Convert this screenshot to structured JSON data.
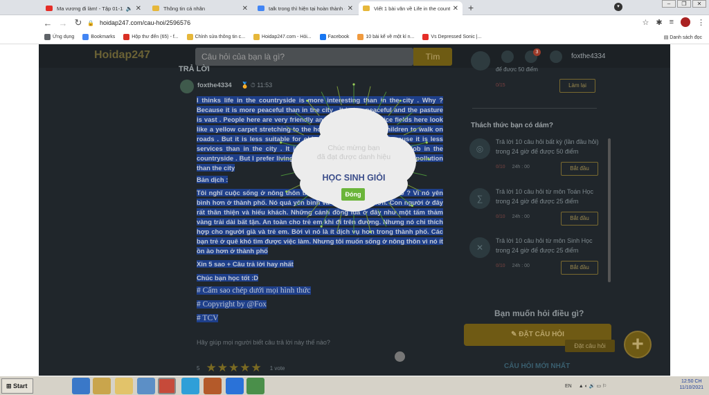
{
  "tabs": [
    {
      "title": "Ma vương đi làm! - Tập 01-13",
      "color": "#e52d27"
    },
    {
      "title": "Thông tin cá nhân",
      "color": "#e6b73a"
    },
    {
      "title": "talk trong thì hiện tại hoàn thành -",
      "color": "#4285f4"
    },
    {
      "title": "Viết 1 bài văn về Life in the country",
      "color": "#e6b73a"
    }
  ],
  "url": "hoidap247.com/cau-hoi/2596576",
  "bookmarks": [
    {
      "label": "Ứng dụng",
      "color": "#5f6368"
    },
    {
      "label": "Bookmarks",
      "color": "#4285f4"
    },
    {
      "label": "Hộp thư đến (65) - f...",
      "color": "#d93025"
    },
    {
      "label": "Chỉnh sửa thông tin c...",
      "color": "#e6b73a"
    },
    {
      "label": "Hoidap247.com - Hỏi...",
      "color": "#e6b73a"
    },
    {
      "label": "Facebook",
      "color": "#1877f2"
    },
    {
      "label": "10 bài kể về một kỉ n...",
      "color": "#f09a3e"
    },
    {
      "label": "Vs Depressed Sonic |...",
      "color": "#e52d27"
    }
  ],
  "reading_list": "Danh sách đọc",
  "site": {
    "logo": "Hoidap247",
    "search_placeholder": "Câu hỏi của bạn là gì?",
    "search_button": "Tìm",
    "notif_count": "3",
    "username": "foxthe4334"
  },
  "answer": {
    "heading": "TRẢ LỜI",
    "author": "foxthe4334",
    "time": "11:53",
    "english": "I thinks life in the countryside is more interesting than in the city . Why ? Because it is more peaceful than in the city . It is too peaceful and the pasture is vast . People here are very friendly and hospitable . The rice fields here look like a yellow carpet stretching to the horizon . It is safe for children to walk on roads . But it is less suitable for old people and children . Because it is less services than in the city . It is hard for young people to find a job in the countryside . But I prefer living in the countryside because it has less pollution than the city",
    "bandich": "Bản dịch :",
    "vietnamese": "Tôi nghĩ cuộc sống ở nông thôn thú vị hơn ở thành phố. Tại sao ? Vì nó yên bình hơn ở thành phố. Nó quá yên bình và đồng cỏ rộng lớn. Con người ở đây rất thân thiện và hiếu khách. Những cánh đồng lúa ở đây như một tấm thảm vàng trải dài bất tận. An toàn cho trẻ em khi đi trên đường. Nhưng nó chỉ thích hợp cho người già và trẻ em. Bởi vì nó là ít dịch vụ hơn trong thành phố. Các bạn trẻ ở quê khó tìm được việc làm. Nhưng tôi muốn sống ở nông thôn vì nó ít ồn ào hơn ở thành phố",
    "line1": "Xin 5 sao + Câu trả lời hay nhất",
    "line2": "Chúc bạn học tốt :D",
    "line3": "# Cấm sao chép dưới mọi hình thức",
    "line4": "# Copyright by @Fox",
    "line5": "# TCV",
    "ask_help": "Hãy giúp mọi người biết câu trả lời này thế nào?",
    "rating": "5",
    "votes": "1 vote"
  },
  "modal": {
    "congrats": "Chúc mừng bạn\nđã đạt được danh hiệu",
    "title": "HỌC SINH GIỎI",
    "button": "Đóng"
  },
  "sidebar": {
    "top_text": "để được 50 điểm",
    "top_progress": "0/15",
    "top_button": "Làm lại",
    "challenge_title": "Thách thức bạn có dám?",
    "challenges": [
      {
        "text": "Trả lời 10 câu hỏi  bất kỳ (lần đầu hỏi) trong 24 giờ để được 50 điểm",
        "progress": "0/10",
        "time": "24h : 00",
        "button": "Bắt đầu"
      },
      {
        "text": "Trả lời 10 câu hỏi  từ môn Toán Học trong 24 giờ để được 25 điểm",
        "progress": "0/10",
        "time": "24h : 00",
        "button": "Bắt đầu"
      },
      {
        "text": "Trả lời 10 câu hỏi  từ môn Sinh Học trong 24 giờ để được 25 điểm",
        "progress": "0/10",
        "time": "24h : 00",
        "button": "Bắt đầu"
      }
    ],
    "want_ask": "Bạn muốn hỏi điều gì?",
    "post_button": "ĐẶT CÂU HỎI",
    "post_label": "Đặt câu hỏi",
    "new_questions": "CÂU HỎI MỚI NHẤT"
  },
  "taskbar": {
    "start": "Start",
    "lang": "EN",
    "time": "12:50 CH",
    "date": "11/10/2021"
  }
}
